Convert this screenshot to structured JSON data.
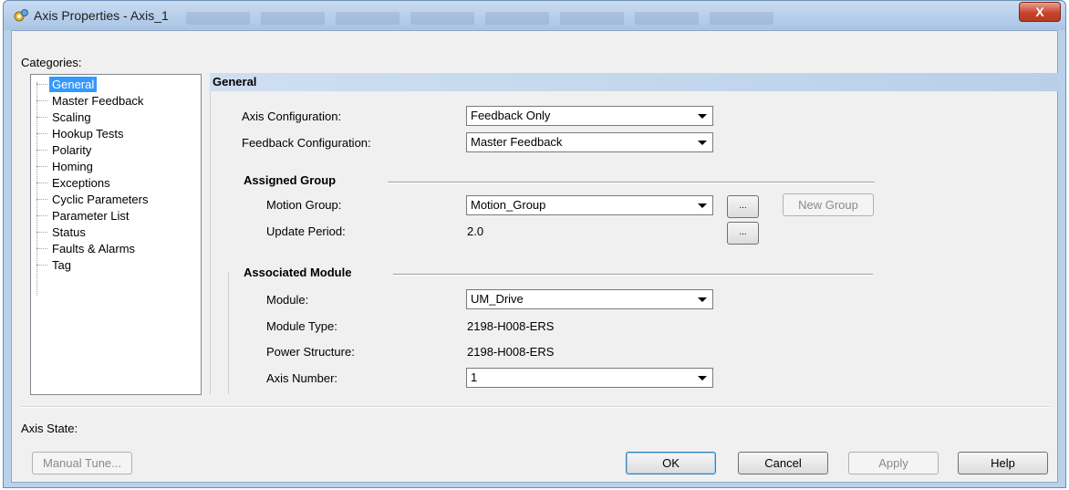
{
  "window": {
    "title": "Axis Properties - Axis_1",
    "close_label": "X"
  },
  "categories": {
    "label": "Categories:",
    "items": [
      {
        "label": "General",
        "selected": true
      },
      {
        "label": "Master Feedback"
      },
      {
        "label": "Scaling"
      },
      {
        "label": "Hookup Tests"
      },
      {
        "label": "Polarity"
      },
      {
        "label": "Homing"
      },
      {
        "label": "Exceptions"
      },
      {
        "label": "Cyclic Parameters"
      },
      {
        "label": "Parameter List"
      },
      {
        "label": "Status"
      },
      {
        "label": "Faults & Alarms"
      },
      {
        "label": "Tag"
      }
    ]
  },
  "general": {
    "header": "General",
    "axis_configuration_label": "Axis Configuration:",
    "axis_configuration_value": "Feedback Only",
    "feedback_configuration_label": "Feedback Configuration:",
    "feedback_configuration_value": "Master Feedback"
  },
  "assigned_group": {
    "title": "Assigned Group",
    "motion_group_label": "Motion Group:",
    "motion_group_value": "Motion_Group",
    "browse_label": "...",
    "new_group_label": "New Group",
    "update_period_label": "Update Period:",
    "update_period_value": "2.0"
  },
  "associated_module": {
    "title": "Associated Module",
    "module_label": "Module:",
    "module_value": "UM_Drive",
    "module_type_label": "Module Type:",
    "module_type_value": "2198-H008-ERS",
    "power_structure_label": "Power Structure:",
    "power_structure_value": "2198-H008-ERS",
    "axis_number_label": "Axis Number:",
    "axis_number_value": "1"
  },
  "footer": {
    "axis_state_label": "Axis State:",
    "manual_tune_label": "Manual Tune...",
    "ok_label": "OK",
    "cancel_label": "Cancel",
    "apply_label": "Apply",
    "help_label": "Help"
  },
  "colors": {
    "selection": "#3399ff",
    "title_bar": "#b9d1ea",
    "close_button": "#c7432b"
  }
}
